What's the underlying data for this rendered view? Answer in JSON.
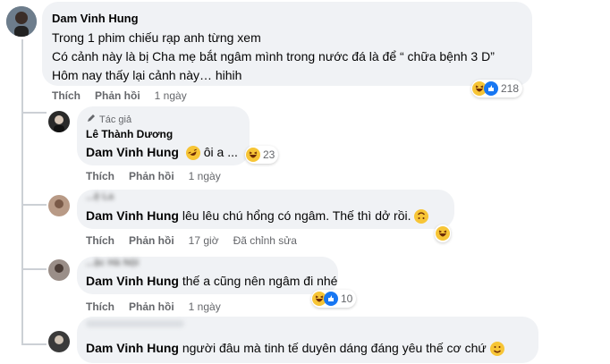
{
  "comment": {
    "author": "Dam Vinh Hung",
    "lines": [
      "Trong 1 phim chiếu rạp anh từng xem",
      "Có cảnh này là bị Cha mẹ bắt ngâm mình trong nước đá là để “ chữa bệnh 3 D”",
      "Hôm nay thấy lại cảnh này… hihih"
    ],
    "actions": {
      "like": "Thích",
      "reply": "Phản hồi",
      "time": "1 ngày"
    },
    "reactions": {
      "count": "218",
      "icons": [
        "haha-icon",
        "like-icon"
      ]
    }
  },
  "replies": [
    {
      "badge": "Tác giả",
      "author": "Lê Thành Dương",
      "mention": "Dam Vinh Hung",
      "text": "ôi a ...",
      "actions": {
        "like": "Thích",
        "reply": "Phản hồi",
        "time": "1 ngày"
      },
      "reactions": {
        "count": "23"
      }
    },
    {
      "author_partial": "...ệ La",
      "mention": "Dam Vinh Hung",
      "text": "lêu lêu chú hổng có ngâm. Thế thì dở rồi.",
      "actions": {
        "like": "Thích",
        "reply": "Phản hồi",
        "time": "17 giờ",
        "edited": "Đã chỉnh sửa"
      }
    },
    {
      "author_partial": "...ặc Hà Nội",
      "mention": "Dam Vinh Hung",
      "text": "thế a cũng nên ngâm đi nhé",
      "actions": {
        "like": "Thích",
        "reply": "Phản hồi",
        "time": "1 ngày"
      },
      "reactions": {
        "count": "10"
      }
    },
    {
      "mention": "Dam Vinh Hung",
      "text": "người đâu mà tinh tế duyên dáng đáng yêu thế cơ chứ"
    }
  ]
}
